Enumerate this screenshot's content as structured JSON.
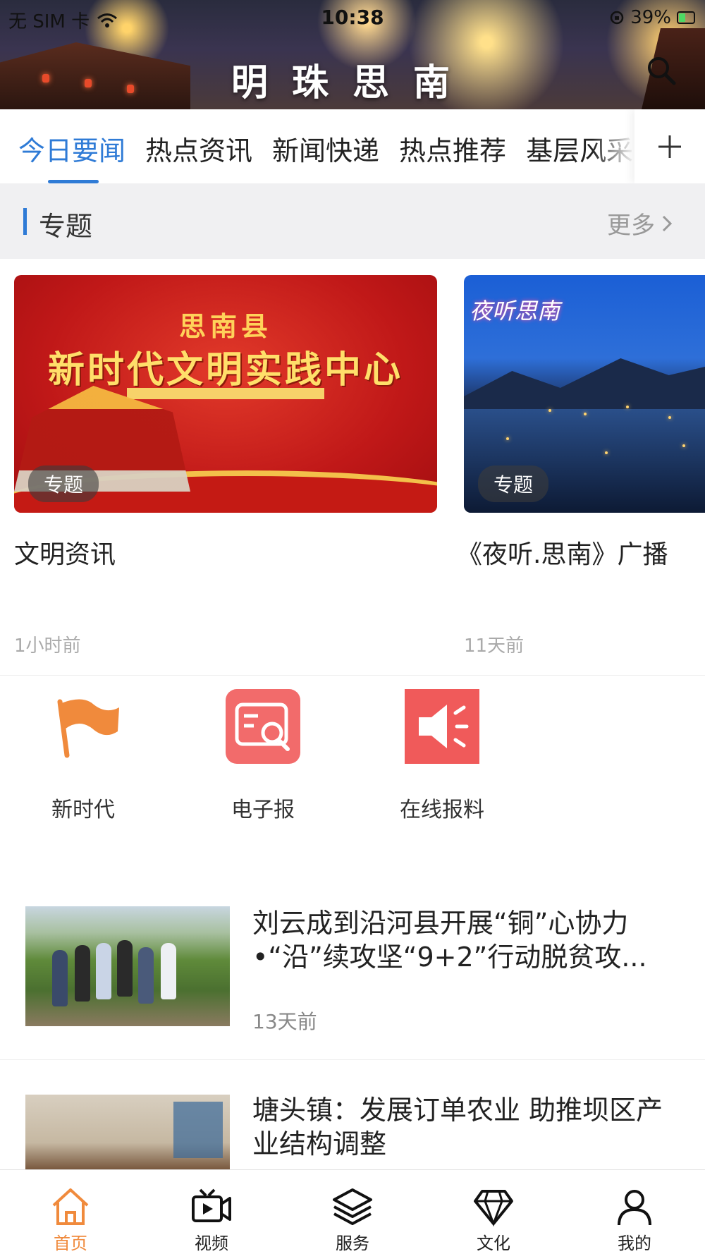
{
  "status_bar": {
    "carrier": "无 SIM 卡",
    "time": "10:38",
    "battery": "39%"
  },
  "header": {
    "title": "明珠思南"
  },
  "tabs": [
    {
      "label": "今日要闻",
      "active": true
    },
    {
      "label": "热点资讯",
      "active": false
    },
    {
      "label": "新闻快递",
      "active": false
    },
    {
      "label": "热点推荐",
      "active": false
    },
    {
      "label": "基层风采",
      "active": false
    }
  ],
  "section": {
    "title": "专题",
    "more": "更多"
  },
  "featured": [
    {
      "badge": "专题",
      "image_text_1": "思南县",
      "image_text_2": "新时代文明实践中心",
      "title": "文明资讯",
      "time": "1小时前"
    },
    {
      "badge": "专题",
      "image_text_1": "夜听思南",
      "title": "《夜听.思南》广播",
      "time": "11天前"
    }
  ],
  "quick_entries": [
    {
      "label": "新时代",
      "icon": "flag-icon",
      "color": "#f08a3c"
    },
    {
      "label": "电子报",
      "icon": "newspaper-search-icon",
      "color": "#f26b6b"
    },
    {
      "label": "在线报料",
      "icon": "speaker-icon",
      "color": "#f05a5a"
    }
  ],
  "news": [
    {
      "title": "刘云成到沿河县开展“铜”心协力•“沿”续攻坚“9+2”行动脱贫攻...",
      "time": "13天前"
    },
    {
      "title": "塘头镇：发展订单农业 助推坝区产业结构调整",
      "time": ""
    }
  ],
  "bottom_nav": [
    {
      "label": "首页",
      "icon": "home-icon",
      "active": true
    },
    {
      "label": "视频",
      "icon": "video-icon",
      "active": false
    },
    {
      "label": "服务",
      "icon": "layers-icon",
      "active": false
    },
    {
      "label": "文化",
      "icon": "diamond-icon",
      "active": false
    },
    {
      "label": "我的",
      "icon": "user-icon",
      "active": false
    }
  ],
  "colors": {
    "accent": "#2f7bd6",
    "nav_active": "#f08a3c"
  }
}
